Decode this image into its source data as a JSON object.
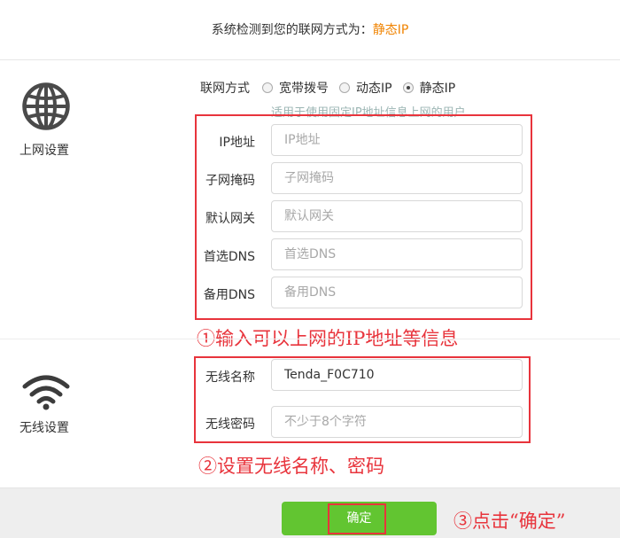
{
  "banner": {
    "detect_prefix": "系统检测到您的联网方式为：",
    "detect_value": "静态IP"
  },
  "internet_section": {
    "label": "上网设置",
    "icon": "globe-icon",
    "connection_label": "联网方式",
    "options": [
      {
        "label": "宽带拨号",
        "selected": false
      },
      {
        "label": "动态IP",
        "selected": false
      },
      {
        "label": "静态IP",
        "selected": true
      }
    ],
    "hint": "适用于使用固定IP地址信息上网的用户",
    "fields": [
      {
        "label": "IP地址",
        "placeholder": "IP地址",
        "value": ""
      },
      {
        "label": "子网掩码",
        "placeholder": "子网掩码",
        "value": ""
      },
      {
        "label": "默认网关",
        "placeholder": "默认网关",
        "value": ""
      },
      {
        "label": "首选DNS",
        "placeholder": "首选DNS",
        "value": ""
      },
      {
        "label": "备用DNS",
        "placeholder": "备用DNS",
        "value": ""
      }
    ]
  },
  "wireless_section": {
    "label": "无线设置",
    "icon": "wifi-icon",
    "fields": [
      {
        "label": "无线名称",
        "placeholder": "",
        "value": "Tenda_F0C710"
      },
      {
        "label": "无线密码",
        "placeholder": "不少于8个字符",
        "value": ""
      }
    ]
  },
  "annotations": {
    "step1": "①输入可以上网的IP地址等信息",
    "step2": "②设置无线名称、密码",
    "step3": "③点击“确定”"
  },
  "footer": {
    "ok_label": "确定"
  },
  "colors": {
    "accent": "#f08300",
    "annotation_red": "#e8343c",
    "button_green": "#62c531"
  }
}
